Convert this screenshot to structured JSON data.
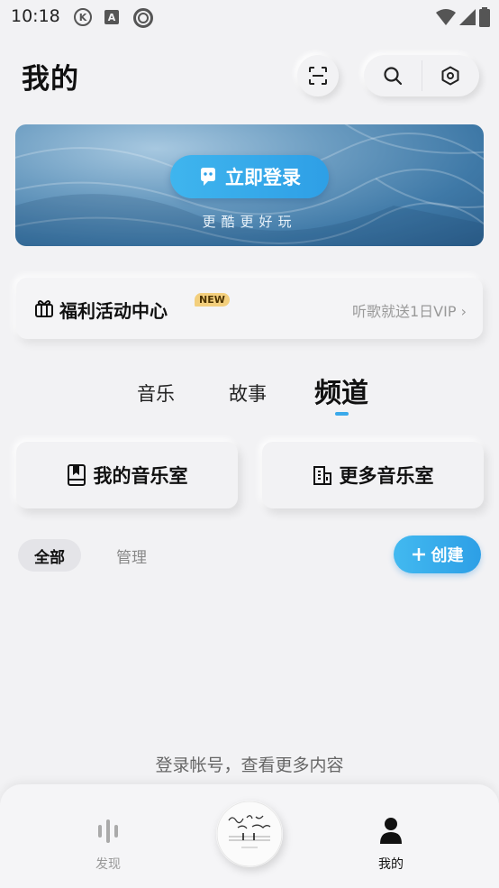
{
  "status_bar": {
    "time": "10:18",
    "icons": [
      "k-icon",
      "a-icon",
      "circle-app-icon",
      "wifi-icon",
      "signal-icon",
      "battery-icon"
    ]
  },
  "header": {
    "title": "我的",
    "scan_icon": "scan-icon",
    "search_icon": "search-icon",
    "settings_icon": "settings-hex-icon"
  },
  "banner": {
    "login_label": "立即登录",
    "subtitle": "更酷更好玩",
    "icon": "robot-face-icon"
  },
  "welfare": {
    "title": "福利活动中心",
    "badge": "NEW",
    "promo": "听歌就送1日VIP",
    "icon": "gift-icon"
  },
  "tabs": [
    {
      "label": "音乐",
      "selected": false
    },
    {
      "label": "故事",
      "selected": false
    },
    {
      "label": "频道",
      "selected": true
    }
  ],
  "rooms": {
    "mine_label": "我的音乐室",
    "more_label": "更多音乐室"
  },
  "filter": {
    "all_label": "全部",
    "manage_label": "管理",
    "create_label": "创建"
  },
  "empty_hint": "登录帐号，查看更多内容",
  "bottom_nav": {
    "discover_label": "发现",
    "mine_label": "我的",
    "accent": "#3aa9ea"
  }
}
